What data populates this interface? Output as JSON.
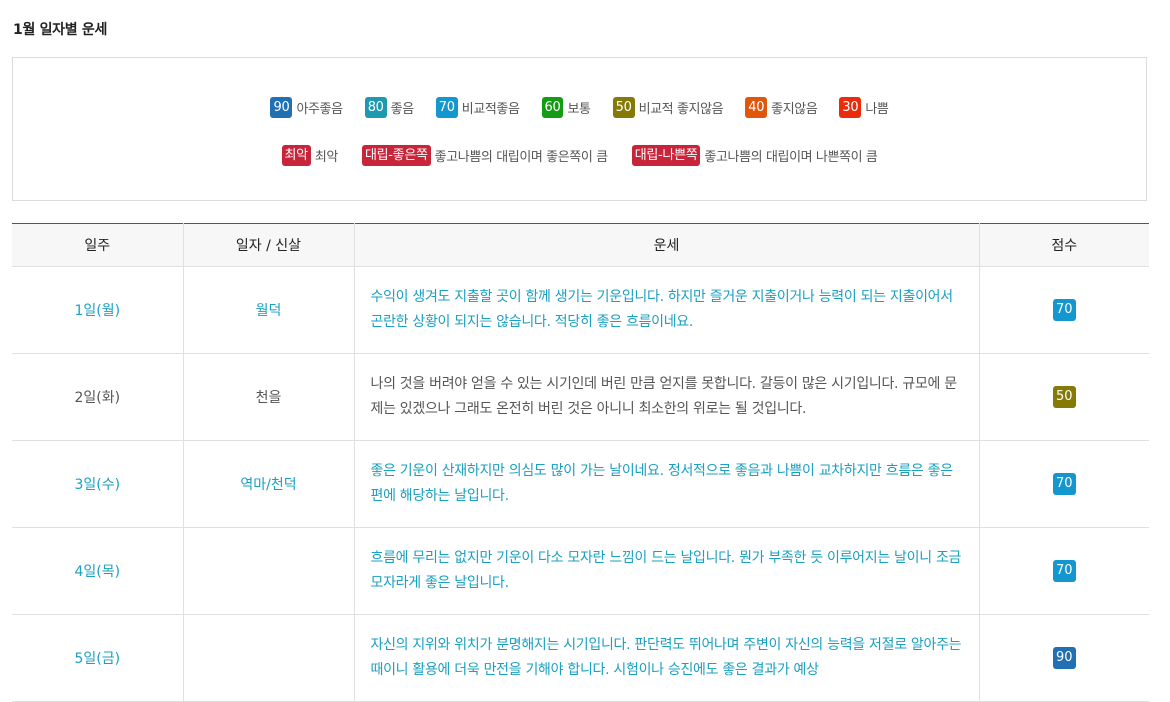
{
  "page_title": "1월 일자별 운세",
  "legend": {
    "scores": [
      {
        "score": "90",
        "label": "아주좋음",
        "color": "#2170b4"
      },
      {
        "score": "80",
        "label": "좋음",
        "color": "#1d9ab0"
      },
      {
        "score": "70",
        "label": "비교적좋음",
        "color": "#1497cf"
      },
      {
        "score": "60",
        "label": "보통",
        "color": "#149c14"
      },
      {
        "score": "50",
        "label": "비교적 좋지않음",
        "color": "#857a07"
      },
      {
        "score": "40",
        "label": "좋지않음",
        "color": "#e0560c"
      },
      {
        "score": "30",
        "label": "나쁨",
        "color": "#ea2c0c"
      }
    ],
    "specials": [
      {
        "badge": "최악",
        "label": "최악",
        "color": "#c8243a"
      },
      {
        "badge": "대립-좋은쪽",
        "label": "좋고나쁨의 대립이며 좋은쪽이 큼",
        "color": "#c8243a"
      },
      {
        "badge": "대립-나쁜쪽",
        "label": "좋고나쁨의 대립이며 나쁜쪽이 큼",
        "color": "#c8243a"
      }
    ]
  },
  "table": {
    "headers": [
      "일주",
      "일자 / 신살",
      "운세",
      "점수"
    ],
    "rows": [
      {
        "day": "1일(월)",
        "sinsal": "월덕",
        "text": "수익이 생겨도 지출할 곳이 함께 생기는 기운입니다. 하지만 즐거운 지출이거나 능력이 되는 지출이어서 곤란한 상황이 되지는 않습니다. 적당히 좋은 흐름이네요.",
        "score": "70",
        "score_color": "#1497cf",
        "tone": "good"
      },
      {
        "day": "2일(화)",
        "sinsal": "천을",
        "text": "나의 것을 버려야 얻을 수 있는 시기인데 버린 만큼 얻지를 못합니다. 갈등이 많은 시기입니다. 규모에 문제는 있겠으나 그래도 온전히 버린 것은 아니니 최소한의 위로는 될 것입니다.",
        "score": "50",
        "score_color": "#857a07",
        "tone": "normal"
      },
      {
        "day": "3일(수)",
        "sinsal": "역마/천덕",
        "text": "좋은 기운이 산재하지만 의심도 많이 가는 날이네요. 정서적으로 좋음과 나쁨이 교차하지만 흐름은 좋은 편에 해당하는 날입니다.",
        "score": "70",
        "score_color": "#1497cf",
        "tone": "good"
      },
      {
        "day": "4일(목)",
        "sinsal": "",
        "text": "흐름에 무리는 없지만 기운이 다소 모자란 느낌이 드는 날입니다. 뭔가 부족한 듯 이루어지는 날이니 조금 모자라게 좋은 날입니다.",
        "score": "70",
        "score_color": "#1497cf",
        "tone": "good"
      },
      {
        "day": "5일(금)",
        "sinsal": "",
        "text": "자신의 지위와 위치가 분명해지는 시기입니다. 판단력도 뛰어나며 주변이 자신의 능력을 저절로 알아주는 때이니 활용에 더욱 만전을 기해야 합니다. 시험이나 승진에도 좋은 결과가 예상",
        "score": "90",
        "score_color": "#2170b4",
        "tone": "good"
      }
    ]
  }
}
